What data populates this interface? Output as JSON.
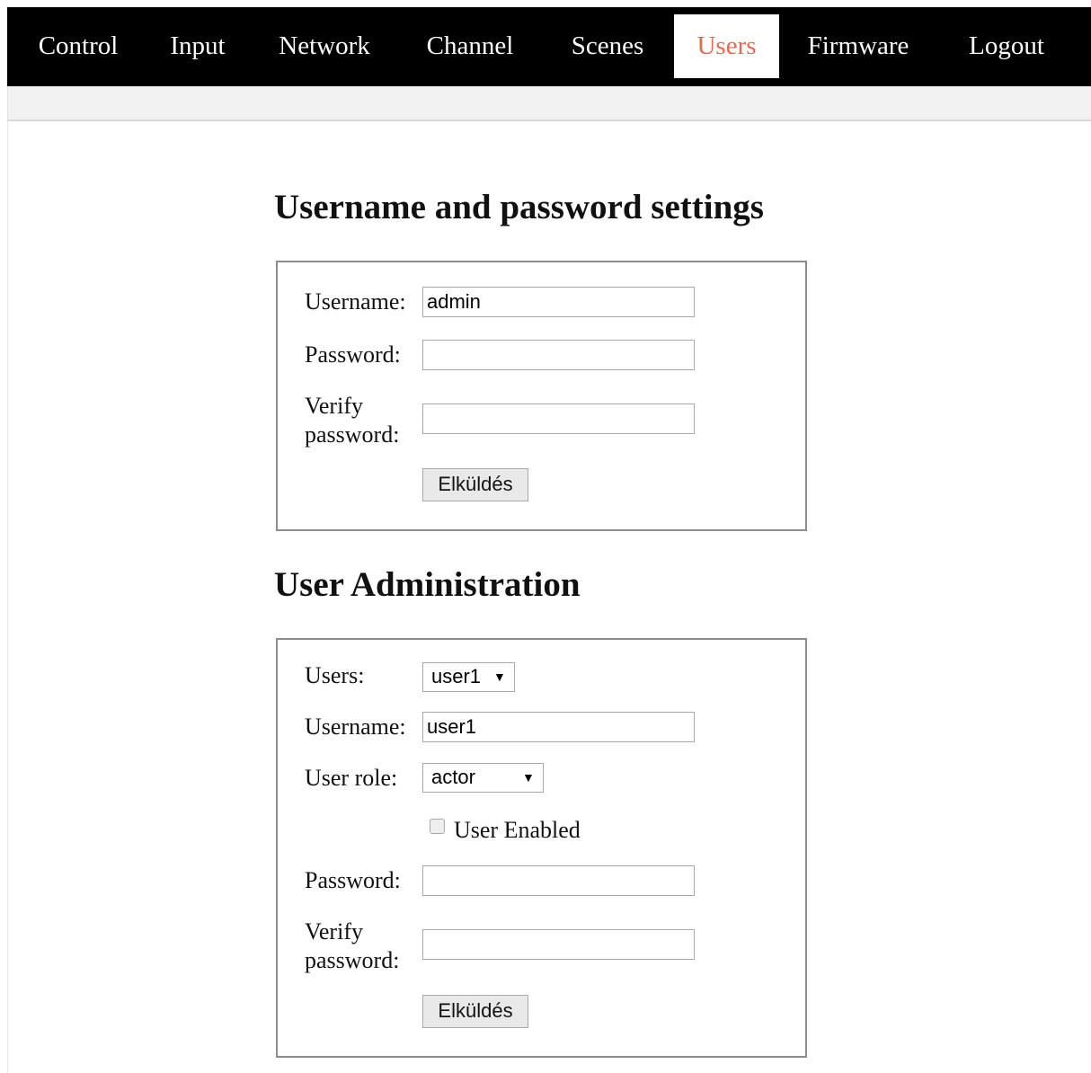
{
  "nav": {
    "items": [
      {
        "label": "Control"
      },
      {
        "label": "Input"
      },
      {
        "label": "Network"
      },
      {
        "label": "Channel"
      },
      {
        "label": "Scenes"
      },
      {
        "label": "Users",
        "active": true
      },
      {
        "label": "Firmware"
      },
      {
        "label": "Logout"
      }
    ]
  },
  "credentials": {
    "title": "Username and password settings",
    "username_label": "Username:",
    "username_value": "admin",
    "password_label": "Password:",
    "password_value": "",
    "verify_label_line1": "Verify",
    "verify_label_line2": "password:",
    "verify_value": "",
    "submit_label": "Elküldés"
  },
  "admin": {
    "title": "User Administration",
    "users_label": "Users:",
    "users_selected": "user1",
    "username_label": "Username:",
    "username_value": "user1",
    "role_label": "User role:",
    "role_selected": "actor",
    "enabled_label": "User Enabled",
    "enabled_checked": false,
    "password_label": "Password:",
    "password_value": "",
    "verify_label_line1": "Verify",
    "verify_label_line2": "password:",
    "verify_value": "",
    "submit_label": "Elküldés"
  },
  "colors": {
    "navbar_bg": "#000000",
    "nav_text": "#ffffff",
    "active_tab_bg": "#ffffff",
    "active_tab_text": "#e8674f"
  }
}
